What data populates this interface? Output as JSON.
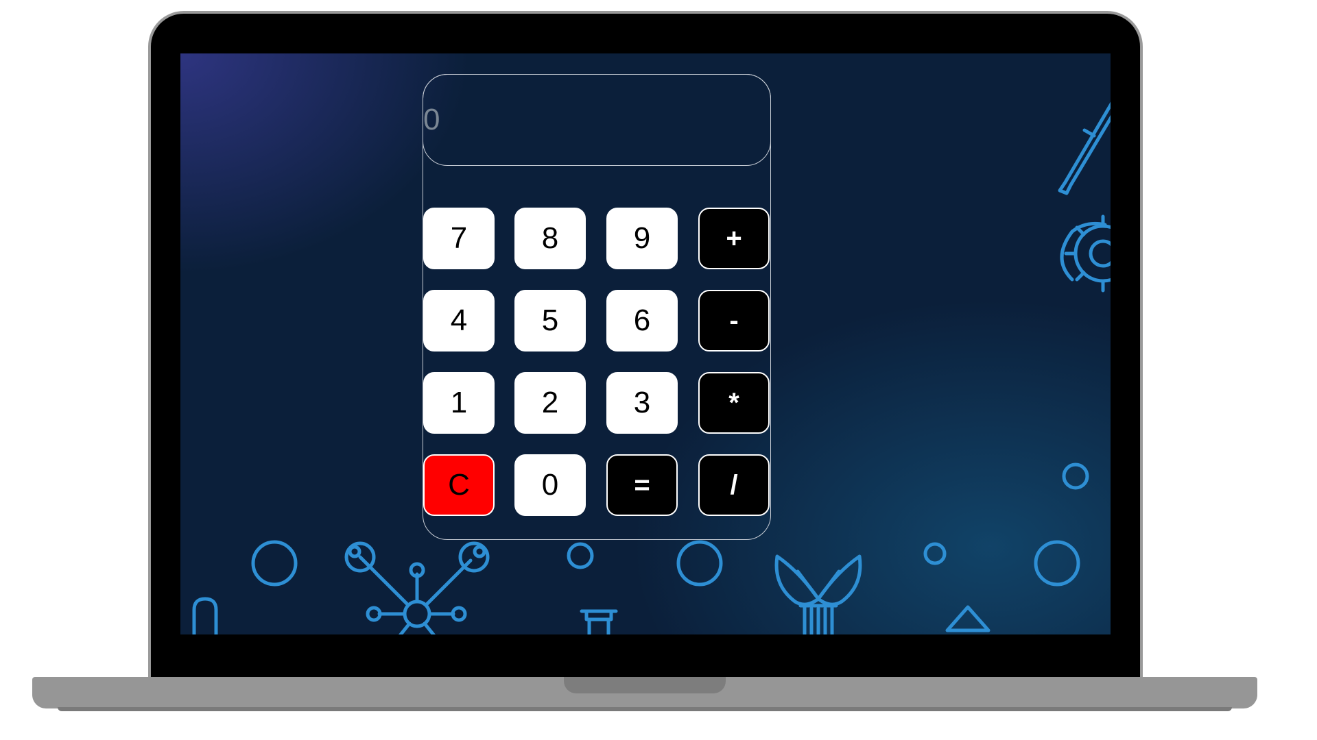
{
  "display": {
    "placeholder": "0"
  },
  "keypad": {
    "row1": [
      "7",
      "8",
      "9",
      "+"
    ],
    "row2": [
      "4",
      "5",
      "6",
      "-"
    ],
    "row3": [
      "1",
      "2",
      "3",
      "*"
    ],
    "row4": [
      "C",
      "0",
      "=",
      "/"
    ]
  },
  "colors": {
    "screen_background": "#0b1f3a",
    "number_key": "#ffffff",
    "operator_key": "#000000",
    "clear_key": "#ff0000",
    "decor_icons": "#2e8fd4"
  },
  "background_icons": [
    "pen-icon",
    "gear-icon",
    "circle-icon",
    "molecule-icon",
    "flask-icon",
    "sprout-icon",
    "triangle-icon"
  ]
}
